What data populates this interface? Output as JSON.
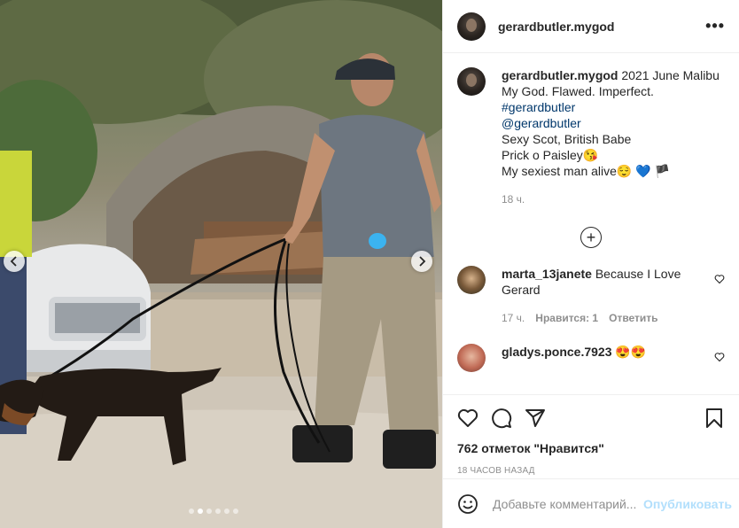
{
  "post": {
    "username": "gerardbutler.mygod",
    "more_icon": "ellipsis-icon"
  },
  "caption": {
    "username": "gerardbutler.mygod",
    "first_line": "2021 June Malibu",
    "line2": "My God. Flawed. Imperfect.",
    "hashtag": "#gerardbutler",
    "mention": "@gerardbutler",
    "line5": "Sexy Scot, British Babe",
    "line6": "Prick o Paisley😘",
    "line7": "My sexiest man alive😌 💙 🏴",
    "age": "18 ч."
  },
  "load_more_icon": "plus-circle-icon",
  "comments": [
    {
      "username": "marta_13janete",
      "text": "Because I Love Gerard",
      "age": "17 ч.",
      "likes": "Нравится: 1",
      "reply": "Ответить"
    },
    {
      "username": "gladys.ponce.7923",
      "text": "😍😍"
    }
  ],
  "actions": {
    "likes_text": "762 отметок \"Нравится\"",
    "time_text": "18 часов назад"
  },
  "add_comment": {
    "placeholder": "Добавьте комментарий...",
    "post_label": "Опубликовать"
  },
  "carousel": {
    "slide_count": 6,
    "active_index": 1
  },
  "colors": {
    "link": "#00376b",
    "muted": "#8e8e8e",
    "post_disabled": "#b2dffc",
    "heart_emoji": "#3bb3f0"
  }
}
